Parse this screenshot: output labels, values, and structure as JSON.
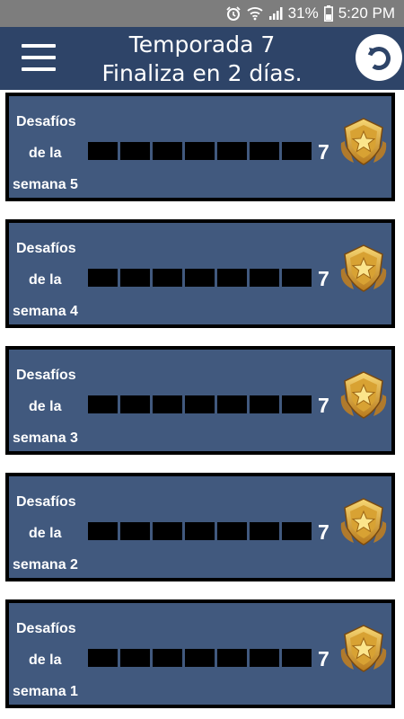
{
  "status_bar": {
    "battery": "31%",
    "time": "5:20 PM",
    "icons": [
      "alarm-icon",
      "wifi-icon",
      "signal-icon",
      "battery-icon"
    ]
  },
  "header": {
    "title_line1": "Temporada 7",
    "title_line2": "Finaliza en 2 días.",
    "menu_icon": "hamburger-menu-icon",
    "refresh_icon": "refresh-icon",
    "background": "#2e4468"
  },
  "colors": {
    "card_background": "#41597e",
    "card_border": "#000000",
    "progress_empty": "#000000"
  },
  "weeks": [
    {
      "line1": "Desafíos",
      "line2": "de la",
      "line3": "semana 5",
      "total": "7",
      "completed": 0
    },
    {
      "line1": "Desafíos",
      "line2": "de la",
      "line3": "semana 4",
      "total": "7",
      "completed": 0
    },
    {
      "line1": "Desafíos",
      "line2": "de la",
      "line3": "semana 3",
      "total": "7",
      "completed": 0
    },
    {
      "line1": "Desafíos",
      "line2": "de la",
      "line3": "semana 2",
      "total": "7",
      "completed": 0
    },
    {
      "line1": "Desafíos",
      "line2": "de la",
      "line3": "semana 1",
      "total": "7",
      "completed": 0
    }
  ]
}
